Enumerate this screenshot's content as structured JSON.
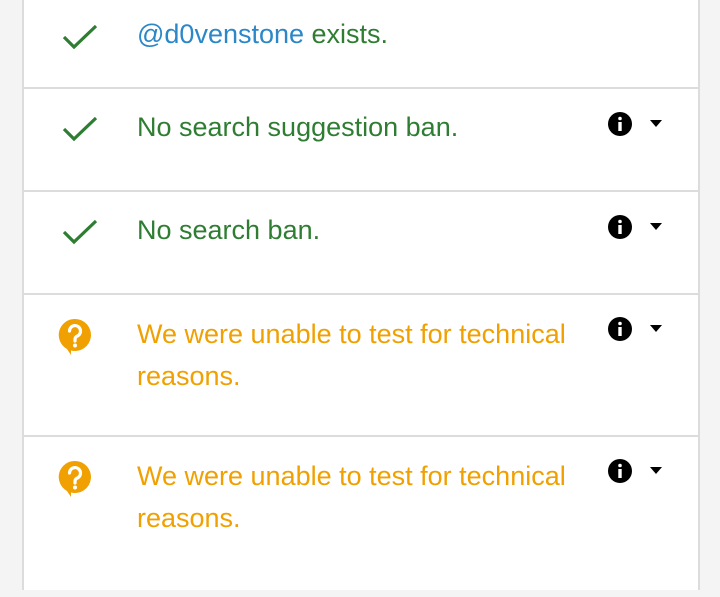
{
  "results": [
    {
      "status": "ok",
      "status_icon": "check-icon",
      "handle": "@d0venstone",
      "text": " exists.",
      "has_details": false
    },
    {
      "status": "ok",
      "status_icon": "check-icon",
      "text": "No search suggestion ban.",
      "has_details": true
    },
    {
      "status": "ok",
      "status_icon": "check-icon",
      "text": "No search ban.",
      "has_details": true
    },
    {
      "status": "unknown",
      "status_icon": "question-bubble-icon",
      "text": "We were unable to test for technical reasons.",
      "has_details": true
    },
    {
      "status": "unknown",
      "status_icon": "question-bubble-icon",
      "text": "We were unable to test for technical reasons.",
      "has_details": true
    }
  ],
  "icons": {
    "details": "info-icon",
    "expand": "caret-down-icon"
  },
  "colors": {
    "ok": "#2e7d32",
    "unknown": "#f0a000",
    "handle": "#2b87c8",
    "divider": "#dcdcdc"
  }
}
